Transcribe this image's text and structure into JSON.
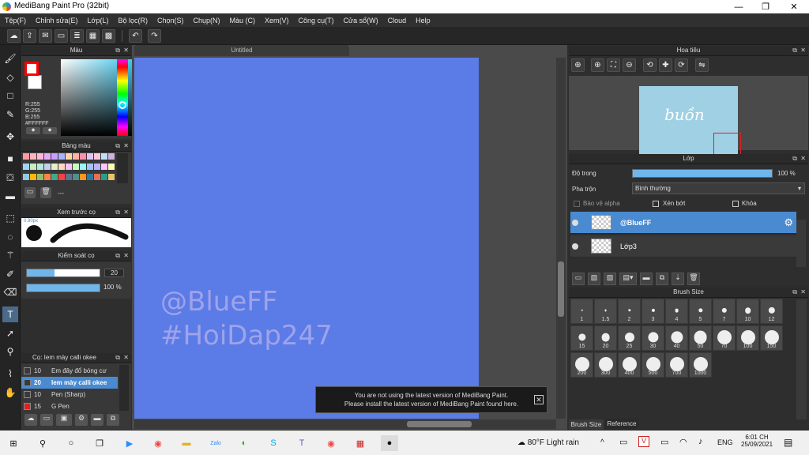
{
  "window": {
    "title": "MediBang Paint Pro (32bit)",
    "minimize": "—",
    "maximize": "❐",
    "close": "✕"
  },
  "menu": [
    "Tệp(F)",
    "Chỉnh sửa(E)",
    "Lớp(L)",
    "Bộ lọc(R)",
    "Chọn(S)",
    "Chụp(N)",
    "Màu (C)",
    "Xem(V)",
    "Công cụ(T)",
    "Cửa sổ(W)",
    "Cloud",
    "Help"
  ],
  "toolbar_icons": [
    "cloud-icon",
    "share-icon",
    "comment-icon",
    "message-icon",
    "layers-icon",
    "grid-icon",
    "grid-small-icon",
    "undo-icon",
    "redo-icon"
  ],
  "left_tools": [
    "brush-icon",
    "eraser-icon",
    "rectangle-icon",
    "pen-icon",
    "move-icon",
    "fill-rect-icon",
    "bucket-icon",
    "gradient-icon",
    "select-rect-icon",
    "lasso-icon",
    "magic-wand-icon",
    "select-pen-icon",
    "select-eraser-icon",
    "text-icon",
    "operation-icon",
    "dropper-icon",
    "hand-icon"
  ],
  "panels": {
    "color": {
      "title": "Màu",
      "fg": "#ff0000",
      "bg": "#ffffff",
      "r": "R:255",
      "g": "G:255",
      "b": "B:255",
      "hex": "#FFFFFF"
    },
    "palette": {
      "title": "Bảng màu",
      "footer": "---",
      "swatches": [
        "#ff9aa2",
        "#ffb3c1",
        "#ffb7d5",
        "#e9a9ff",
        "#c9a0ff",
        "#a5b4fc",
        "#ffd6a5",
        "#ffb4a2",
        "#ff8fab",
        "#e0c3fc",
        "#ffc8dd",
        "#bde0fe",
        "#cdb4db",
        "#a2d2ff",
        "#cdeac0",
        "#b5ead7",
        "#c7ceea",
        "#e2f0cb",
        "#ffdac1",
        "#f3c4fb",
        "#caffbf",
        "#9bf6ff",
        "#a0c4ff",
        "#bdb2ff",
        "#ffc6ff",
        "#fdffb6",
        "#8ecae6",
        "#ffb703",
        "#90be6d",
        "#f9844a",
        "#43aa8b",
        "#f94144",
        "#577590",
        "#4d908e",
        "#f8961e",
        "#277da1",
        "#e76f51",
        "#2a9d8f",
        "#e9c46a"
      ]
    },
    "brush_preview": {
      "title": "Xem trước cọ",
      "size_label": "0.80px"
    },
    "brush_control": {
      "title": "Kiểm soát cọ",
      "size_value": "20",
      "size_fraction": 0.38,
      "opacity_value": "100 %",
      "opacity_fraction": 1.0
    },
    "brush_list": {
      "title": "Cọ: Iem mày calli okee",
      "items": [
        {
          "size": "10",
          "name": "Em đây đổ bóng cư",
          "color": "#3a3a3a",
          "selected": false
        },
        {
          "size": "20",
          "name": "Iem mày calli okee",
          "color": "#3a3a3a",
          "selected": true
        },
        {
          "size": "10",
          "name": "Pen (Sharp)",
          "color": "#3a3a3a",
          "selected": false
        },
        {
          "size": "15",
          "name": "G Pen",
          "color": "#e02020",
          "selected": false
        }
      ]
    },
    "navigator": {
      "title": "Hoa tiêu",
      "thumb_text": "buồn"
    },
    "layer": {
      "title": "Lớp",
      "opacity_label": "Độ trong",
      "opacity_value": "100 %",
      "opacity_fraction": 1.0,
      "blend_label": "Pha trộn",
      "blend_value": "Bình thường",
      "protect_alpha": "Bảo vệ alpha",
      "clipping": "Xén bớt",
      "lock": "Khóa",
      "layers": [
        {
          "name": "@BlueFF",
          "selected": true
        },
        {
          "name": "Lớp3",
          "selected": false
        }
      ]
    },
    "brush_size": {
      "title": "Brush Size",
      "sizes": [
        "1",
        "1.5",
        "2",
        "3",
        "4",
        "5",
        "7",
        "10",
        "12",
        "15",
        "20",
        "25",
        "30",
        "40",
        "50",
        "70",
        "100",
        "150",
        "200",
        "300",
        "400",
        "500",
        "700",
        "1000"
      ],
      "tab_brush_size": "Brush Size",
      "tab_reference": "Reference"
    }
  },
  "document": {
    "tab_title": "Untitled",
    "watermark_line1": "@BlueFF",
    "watermark_line2": "#HoiDap247",
    "canvas_color": "#5b7be6"
  },
  "notice": {
    "line1": "You are not using the latest version of MediBang Paint.",
    "line2": "Please install the latest version of MediBang Paint found here."
  },
  "taskbar": {
    "weather": "80°F  Light rain",
    "lang": "ENG",
    "time": "6:01 CH",
    "date": "25/09/2021",
    "apps": [
      "windows-icon",
      "search-icon",
      "cortana-icon",
      "task-view-icon",
      "zoom-icon",
      "chrome-icon",
      "folder-icon",
      "zalo-icon",
      "app-icon",
      "skype-icon",
      "teams-icon",
      "chrome-icon-2",
      "paint-icon",
      "medibang-icon"
    ]
  }
}
